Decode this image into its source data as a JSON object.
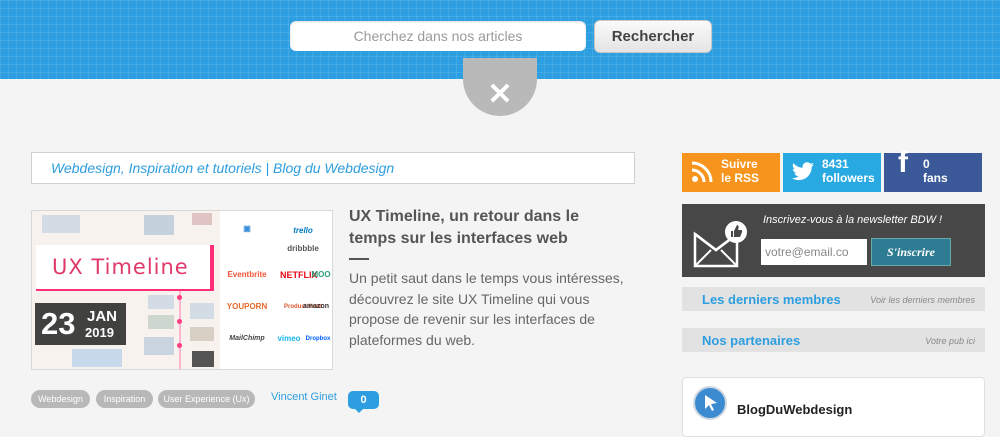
{
  "header": {
    "search_placeholder": "Cherchez dans nos articles",
    "search_button": "Rechercher",
    "close_symbol": "✕"
  },
  "breadcrumb": "Webdesign, Inspiration et tutoriels | Blog du Webdesign",
  "article": {
    "title": "UX Timeline, un retour dans le temps sur les interfaces web",
    "excerpt": "Un petit saut dans le temps vous intéresses, découvrez le site UX Timeline qui vous propose de revenir sur les interfaces de plateformes du web.",
    "thumbnail": {
      "heading": "UX Timeline",
      "logos": [
        "trello",
        "dribbble",
        "Eventbrite",
        "NETFLIX",
        "MOO",
        "YOUPORN",
        "Product Hunt",
        "amazon",
        "MailChimp",
        "vimeo",
        "Dropbox"
      ]
    },
    "date": {
      "day": "23",
      "month": "JAN",
      "year": "2019"
    },
    "tags": [
      "Webdesign",
      "Inspiration",
      "User Experience (Ux)"
    ],
    "author": "Vincent Ginet",
    "comments": "0"
  },
  "social": {
    "rss": {
      "line1": "Suivre",
      "line2": "le RSS",
      "color": "#f7941d"
    },
    "twitter": {
      "line1": "8431",
      "line2": "followers",
      "color": "#29a9e1"
    },
    "facebook": {
      "line1": "0",
      "line2": "fans",
      "color": "#3b5998"
    }
  },
  "newsletter": {
    "text": "Inscrivez-vous à la newsletter BDW !",
    "email_placeholder": "votre@email.co",
    "button": "S'inscrire"
  },
  "members": {
    "title": "Les derniers membres",
    "link": "Voir les derniers membres"
  },
  "partners": {
    "title": "Nos partenaires",
    "link": "Votre pub ici"
  },
  "facebook_box": {
    "name": "BlogDuWebdesign"
  },
  "colors": {
    "accent": "#2d9ee0",
    "tag_bg": "#b8b8b8"
  }
}
